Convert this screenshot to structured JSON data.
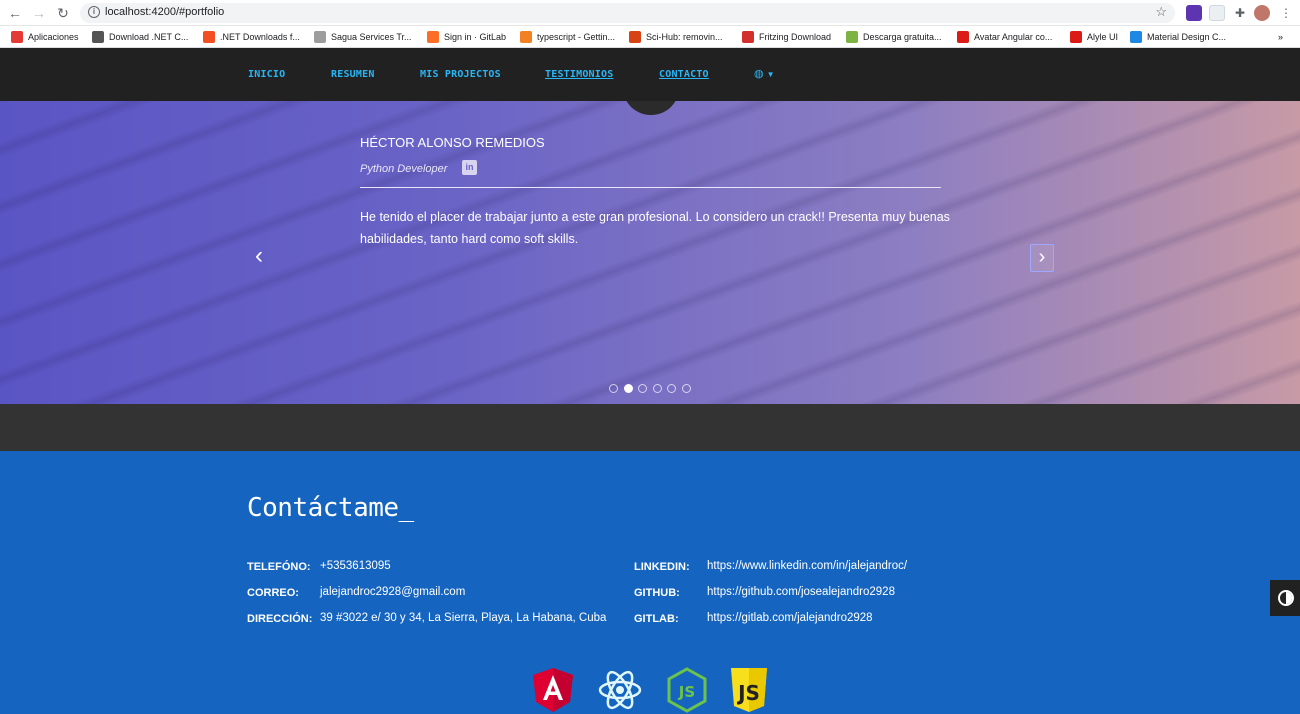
{
  "browser": {
    "url": "localhost:4200/#portfolio",
    "bookmarks": [
      {
        "label": "Aplicaciones",
        "icon": "apps-grid-icon",
        "color": "#e53935"
      },
      {
        "label": "Download .NET C...",
        "icon": "globe-icon",
        "color": "#555555"
      },
      {
        "label": ".NET Downloads f...",
        "icon": "microsoft-icon",
        "color": "#f25022"
      },
      {
        "label": "Sagua Services Tr...",
        "icon": "sagua-icon",
        "color": "#9e9e9e"
      },
      {
        "label": "Sign in · GitLab",
        "icon": "gitlab-icon",
        "color": "#fc6d26"
      },
      {
        "label": "typescript - Gettin...",
        "icon": "stackoverflow-icon",
        "color": "#f48024"
      },
      {
        "label": "Sci-Hub: removin...",
        "icon": "scihub-icon",
        "color": "#d84315"
      },
      {
        "label": "Fritzing Download",
        "icon": "fritzing-icon",
        "color": "#d32f2f"
      },
      {
        "label": "Descarga gratuita...",
        "icon": "download-arrow-icon",
        "color": "#7cb342"
      },
      {
        "label": "Avatar Angular co...",
        "icon": "angular-icon",
        "color": "#dd1b16"
      },
      {
        "label": "Alyle UI",
        "icon": "angular-icon",
        "color": "#dd1b16"
      },
      {
        "label": "Material Design C...",
        "icon": "material-icon",
        "color": "#1e88e5"
      }
    ]
  },
  "nav": {
    "items": [
      {
        "label": "INICIO"
      },
      {
        "label": "RESUMEN"
      },
      {
        "label": "MIS PROJECTOS"
      },
      {
        "label": "TESTIMONIOS"
      },
      {
        "label": "CONTACTO"
      }
    ],
    "language_icon": "globe-icon"
  },
  "testimonial": {
    "name": "HÉCTOR ALONSO REMEDIOS",
    "role": "Python Developer",
    "quote": "He tenido el placer de trabajar junto a este gran profesional. Lo considero un crack!! Presenta muy buenas habilidades, tanto hard como soft skills.",
    "dots_total": 6,
    "active_dot": 2
  },
  "contact": {
    "title": "Contáctame_",
    "left": [
      {
        "label": "TELEFÓNO:",
        "value": "+5353613095"
      },
      {
        "label": "CORREO:",
        "value": "jalejandroc2928@gmail.com"
      },
      {
        "label": "DIRECCIÓN:",
        "value": "39 #3022 e/ 30 y 34, La Sierra, Playa, La Habana, Cuba"
      }
    ],
    "right": [
      {
        "label": "LINKEDIN:",
        "value": "https://www.linkedin.com/in/jalejandroc/"
      },
      {
        "label": "GITHUB:",
        "value": "https://github.com/josealejandro2928"
      },
      {
        "label": "GITLAB:",
        "value": "https://gitlab.com/jalejandro2928"
      }
    ],
    "tech_icons": [
      "angular-icon",
      "react-icon",
      "nodejs-icon",
      "javascript-icon"
    ]
  },
  "colors": {
    "accent": "#29b6f6",
    "contact_bg": "#1565c0",
    "nav_bg": "#212121"
  }
}
